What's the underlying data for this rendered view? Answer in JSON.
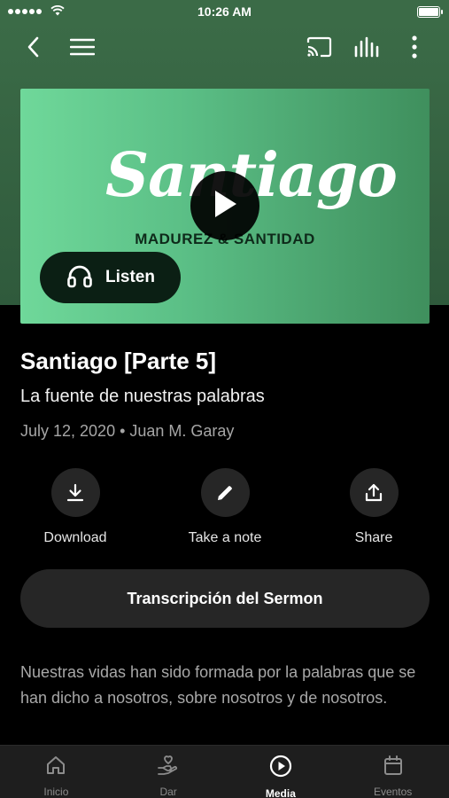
{
  "status_bar": {
    "time": "10:26 AM"
  },
  "nav": {
    "icons": [
      "back-arrow-icon",
      "menu-icon",
      "cast-icon",
      "audio-levels-icon",
      "more-vertical-icon"
    ]
  },
  "artwork": {
    "script_title": "Santiago",
    "subtitle": "MADUREZ & SANTIDAD",
    "play_icon": "play-icon"
  },
  "listen_button": {
    "label": "Listen",
    "icon": "headphones-icon"
  },
  "sermon": {
    "title": "Santiago [Parte 5]",
    "subtitle": "La fuente de nuestras palabras",
    "meta": "July 12, 2020 • Juan M. Garay"
  },
  "actions": [
    {
      "label": "Download",
      "icon": "download-icon"
    },
    {
      "label": "Take a note",
      "icon": "pencil-icon"
    },
    {
      "label": "Share",
      "icon": "share-icon"
    }
  ],
  "transcript_button": {
    "label": "Transcripción del Sermon"
  },
  "description": "Nuestras vidas han sido formada por la palabras que se han dicho a nosotros, sobre nosotros y de nosotros.",
  "tabs": [
    {
      "label": "Inicio",
      "icon": "home-icon",
      "active": false
    },
    {
      "label": "Dar",
      "icon": "give-hand-heart-icon",
      "active": false
    },
    {
      "label": "Media",
      "icon": "play-circle-icon",
      "active": true
    },
    {
      "label": "Eventos",
      "icon": "calendar-icon",
      "active": false
    }
  ],
  "colors": {
    "header_green": "#3b6b47",
    "artwork_green": "#6fd89a",
    "background": "#000000",
    "button_dark": "#262626",
    "tab_bar": "#1e1e1e"
  }
}
